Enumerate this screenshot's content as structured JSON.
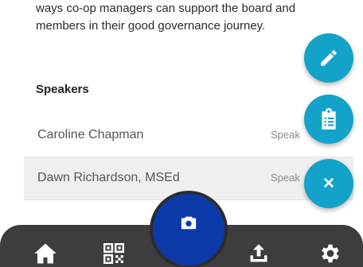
{
  "description": {
    "line1": "ways co-op managers can support the board and",
    "line2": "members in their good governance journey."
  },
  "speakers": {
    "title": "Speakers",
    "items": [
      {
        "name": "Caroline Chapman",
        "role": "Speak"
      },
      {
        "name": "Dawn Richardson, MSEd",
        "role": "Speak"
      }
    ]
  },
  "fabs": {
    "edit_icon": "pencil-icon",
    "clipboard_icon": "clipboard-list-icon",
    "close_label": "×"
  },
  "tabbar": {
    "items": [
      "home-icon",
      "qr-code-icon",
      "camera-icon",
      "upload-icon",
      "gear-icon"
    ]
  },
  "colors": {
    "fab": "#13a3c9",
    "camera_button": "#0c3aa8",
    "tabbar": "#3d3d3d"
  }
}
